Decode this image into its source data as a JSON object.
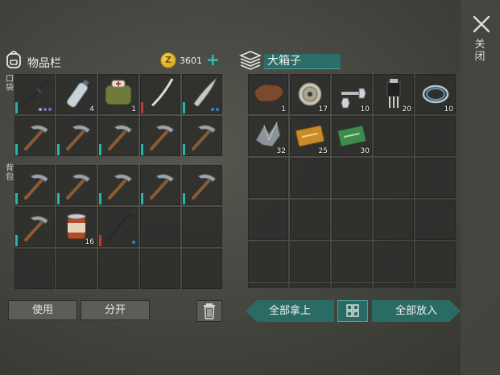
{
  "inventory": {
    "title": "物品栏",
    "coin_symbol": "Z",
    "coins": "3601",
    "plus": "+",
    "pocket_label": "口袋",
    "backpack_label": "背包",
    "pocket_slots": [
      {
        "item": "rifle-icon",
        "rarity": "#2bb5a8",
        "dots": [
          "#a5a5a5",
          "#7f6bc0",
          "#7f6bc0"
        ]
      },
      {
        "item": "water-bottle-icon",
        "count": "4"
      },
      {
        "item": "medkit-bag-icon",
        "count": "1"
      },
      {
        "item": "katana-icon",
        "rarity": "#c0392b"
      },
      {
        "item": "machete-icon",
        "rarity": "#2bb5a8",
        "dots": [
          "#2f7fd0",
          "#2f7fd0"
        ]
      },
      {
        "item": "pickaxe-icon",
        "rarity": "#2bb5a8"
      },
      {
        "item": "pickaxe-icon",
        "rarity": "#2bb5a8"
      },
      {
        "item": "pickaxe-icon",
        "rarity": "#2bb5a8"
      },
      {
        "item": "pickaxe-icon",
        "rarity": "#2bb5a8"
      },
      {
        "item": "pickaxe-icon",
        "rarity": "#2bb5a8"
      }
    ],
    "backpack_slots": [
      {
        "item": "pickaxe-icon",
        "rarity": "#2bb5a8"
      },
      {
        "item": "pickaxe-icon",
        "rarity": "#2bb5a8"
      },
      {
        "item": "pickaxe-icon",
        "rarity": "#2bb5a8"
      },
      {
        "item": "pickaxe-icon",
        "rarity": "#2bb5a8"
      },
      {
        "item": "pickaxe-icon",
        "rarity": "#2bb5a8"
      },
      {
        "item": "pickaxe-icon",
        "rarity": "#2bb5a8"
      },
      {
        "item": "canned-food-icon",
        "count": "16"
      },
      {
        "item": "crowbar-icon",
        "rarity": "#c0392b",
        "dots": [
          "#2f7fd0"
        ]
      },
      {},
      {},
      {},
      {},
      {},
      {},
      {}
    ],
    "use_button": "使用",
    "split_button": "分开",
    "trash_icon": "trash-icon"
  },
  "chest": {
    "title": "大箱子",
    "slots": [
      {
        "item": "leather-icon",
        "count": "1"
      },
      {
        "item": "wire-spool-icon",
        "count": "17"
      },
      {
        "item": "nuts-bolts-icon",
        "count": "10"
      },
      {
        "item": "transistor-icon",
        "count": "20"
      },
      {
        "item": "copper-wire-icon",
        "count": "10"
      },
      {
        "item": "scrap-metal-icon",
        "count": "32"
      },
      {
        "item": "coupon-gold-icon",
        "count": "25"
      },
      {
        "item": "coupon-green-icon",
        "count": "30"
      },
      {},
      {},
      {},
      {},
      {},
      {},
      {},
      {},
      {},
      {},
      {},
      {},
      {},
      {},
      {},
      {},
      {},
      {},
      {},
      {},
      {},
      {},
      {}
    ],
    "take_all": "全部拿上",
    "put_all": "全部放入",
    "sort_icon": "sort-grid-icon"
  },
  "close_label": "关闭",
  "colors": {
    "accent": "#2b6b66",
    "highlight": "#2fc5b5",
    "coin": "#e1b52f"
  }
}
